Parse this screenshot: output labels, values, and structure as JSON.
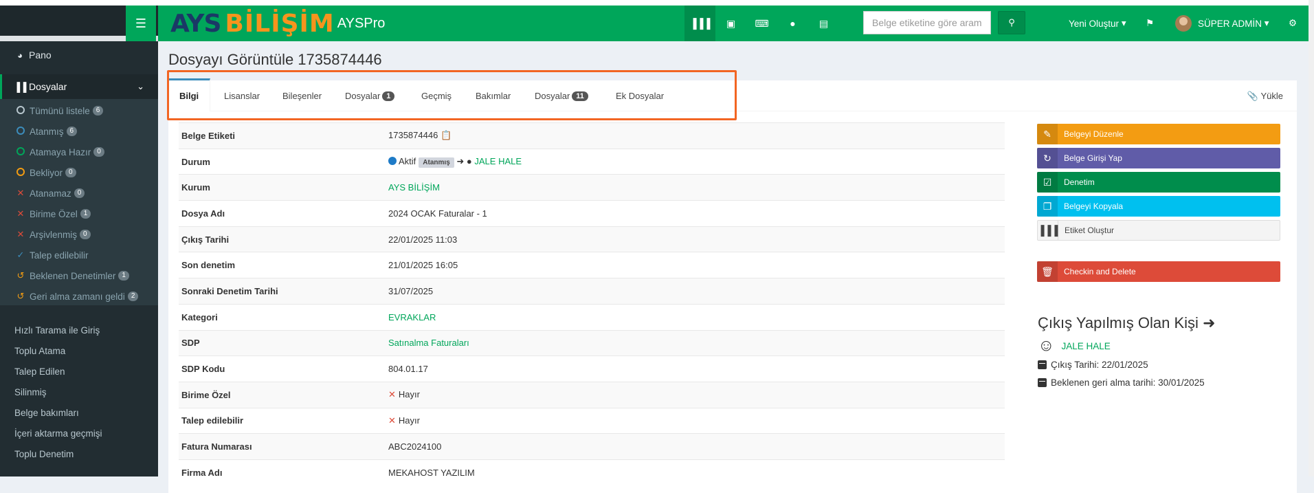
{
  "header": {
    "logo_ays": "AYS",
    "logo_bilisim": "BİLİŞİM",
    "logo_pro": "AYSPro",
    "search_placeholder": "Belge etiketine göre aram",
    "new_label": "Yeni Oluştur",
    "user_name": "SÜPER ADMİN",
    "icons": [
      "barcode-icon",
      "save-icon",
      "keyboard-icon",
      "tint-icon",
      "hdd-icon"
    ]
  },
  "sidebar": {
    "pano": "Pano",
    "dosyalar": "Dosyalar",
    "sub": [
      {
        "label": "Tümünü listele",
        "count": "6",
        "marker": "circle",
        "color": "#b8c7ce"
      },
      {
        "label": "Atanmış",
        "count": "6",
        "marker": "circle",
        "color": "#3c8dbc"
      },
      {
        "label": "Atamaya Hazır",
        "count": "0",
        "marker": "circle",
        "color": "#00a65a"
      },
      {
        "label": "Bekliyor",
        "count": "0",
        "marker": "circle",
        "color": "#f39c12"
      },
      {
        "label": "Atanamaz",
        "count": "0",
        "marker": "x",
        "color": "#dd4b39"
      },
      {
        "label": "Birime Özel",
        "count": "1",
        "marker": "x",
        "color": "#dd4b39"
      },
      {
        "label": "Arşivlenmiş",
        "count": "0",
        "marker": "x",
        "color": "#dd4b39"
      },
      {
        "label": "Talep edilebilir",
        "count": "",
        "marker": "check",
        "color": "#3c8dbc"
      },
      {
        "label": "Beklenen Denetimler",
        "count": "1",
        "marker": "history",
        "color": "#f39c12"
      },
      {
        "label": "Geri alma zamanı geldi",
        "count": "2",
        "marker": "history",
        "color": "#f39c12"
      }
    ],
    "links": [
      "Hızlı Tarama ile Giriş",
      "Toplu Atama",
      "Talep Edilen",
      "Silinmiş",
      "Belge bakımları",
      "İçeri aktarma geçmişi",
      "Toplu Denetim"
    ]
  },
  "page": {
    "title": "Dosyayı Görüntüle 1735874446",
    "upload": "Yükle"
  },
  "tabs": [
    {
      "label": "Bilgi",
      "badge": ""
    },
    {
      "label": "Lisanslar",
      "badge": ""
    },
    {
      "label": "Bileşenler",
      "badge": ""
    },
    {
      "label": "Dosyalar",
      "badge": "1"
    },
    {
      "label": "Geçmiş",
      "badge": ""
    },
    {
      "label": "Bakımlar",
      "badge": ""
    },
    {
      "label": "Dosyalar",
      "badge": "11"
    },
    {
      "label": "Ek Dosyalar",
      "badge": ""
    }
  ],
  "info": {
    "belge_etiketi_k": "Belge Etiketi",
    "belge_etiketi_v": "1735874446",
    "durum_k": "Durum",
    "durum_status": "Aktif",
    "durum_label": "Atanmış",
    "durum_user": "JALE HALE",
    "kurum_k": "Kurum",
    "kurum_v": "AYS BİLİŞİM",
    "dosya_adi_k": "Dosya Adı",
    "dosya_adi_v": "2024 OCAK Faturalar - 1",
    "cikis_k": "Çıkış Tarihi",
    "cikis_v": "22/01/2025 11:03",
    "son_denetim_k": "Son denetim",
    "son_denetim_v": "21/01/2025 16:05",
    "sonraki_k": "Sonraki Denetim Tarihi",
    "sonraki_v": "31/07/2025",
    "kategori_k": "Kategori",
    "kategori_v": "EVRAKLAR",
    "sdp_k": "SDP",
    "sdp_v": "Satınalma Faturaları",
    "sdp_kodu_k": "SDP Kodu",
    "sdp_kodu_v": "804.01.17",
    "birime_k": "Birime Özel",
    "birime_v": "Hayır",
    "talep_k": "Talep edilebilir",
    "talep_v": "Hayır",
    "fatura_k": "Fatura Numarası",
    "fatura_v": "ABC2024100",
    "firma_k": "Firma Adı",
    "firma_v": "MEKAHOST YAZILIM"
  },
  "actions": {
    "edit": "Belgeyi Düzenle",
    "checkin": "Belge Girişi Yap",
    "audit": "Denetim",
    "copy": "Belgeyi Kopyala",
    "label": "Etiket Oluştur",
    "delete": "Checkin and Delete"
  },
  "checkout": {
    "title": "Çıkış Yapılmış Olan Kişi",
    "user": "JALE HALE",
    "date": "Çıkış Tarihi: 22/01/2025",
    "expected": "Beklenen geri alma tarihi: 30/01/2025"
  },
  "colors": {
    "header": "#00a65a",
    "sidebar": "#222d32",
    "edit": "#f39c12",
    "checkin": "#605ca8",
    "audit": "#008d4c",
    "copy": "#00c0ef",
    "delete": "#dd4b39",
    "highlight": "#f26522"
  }
}
